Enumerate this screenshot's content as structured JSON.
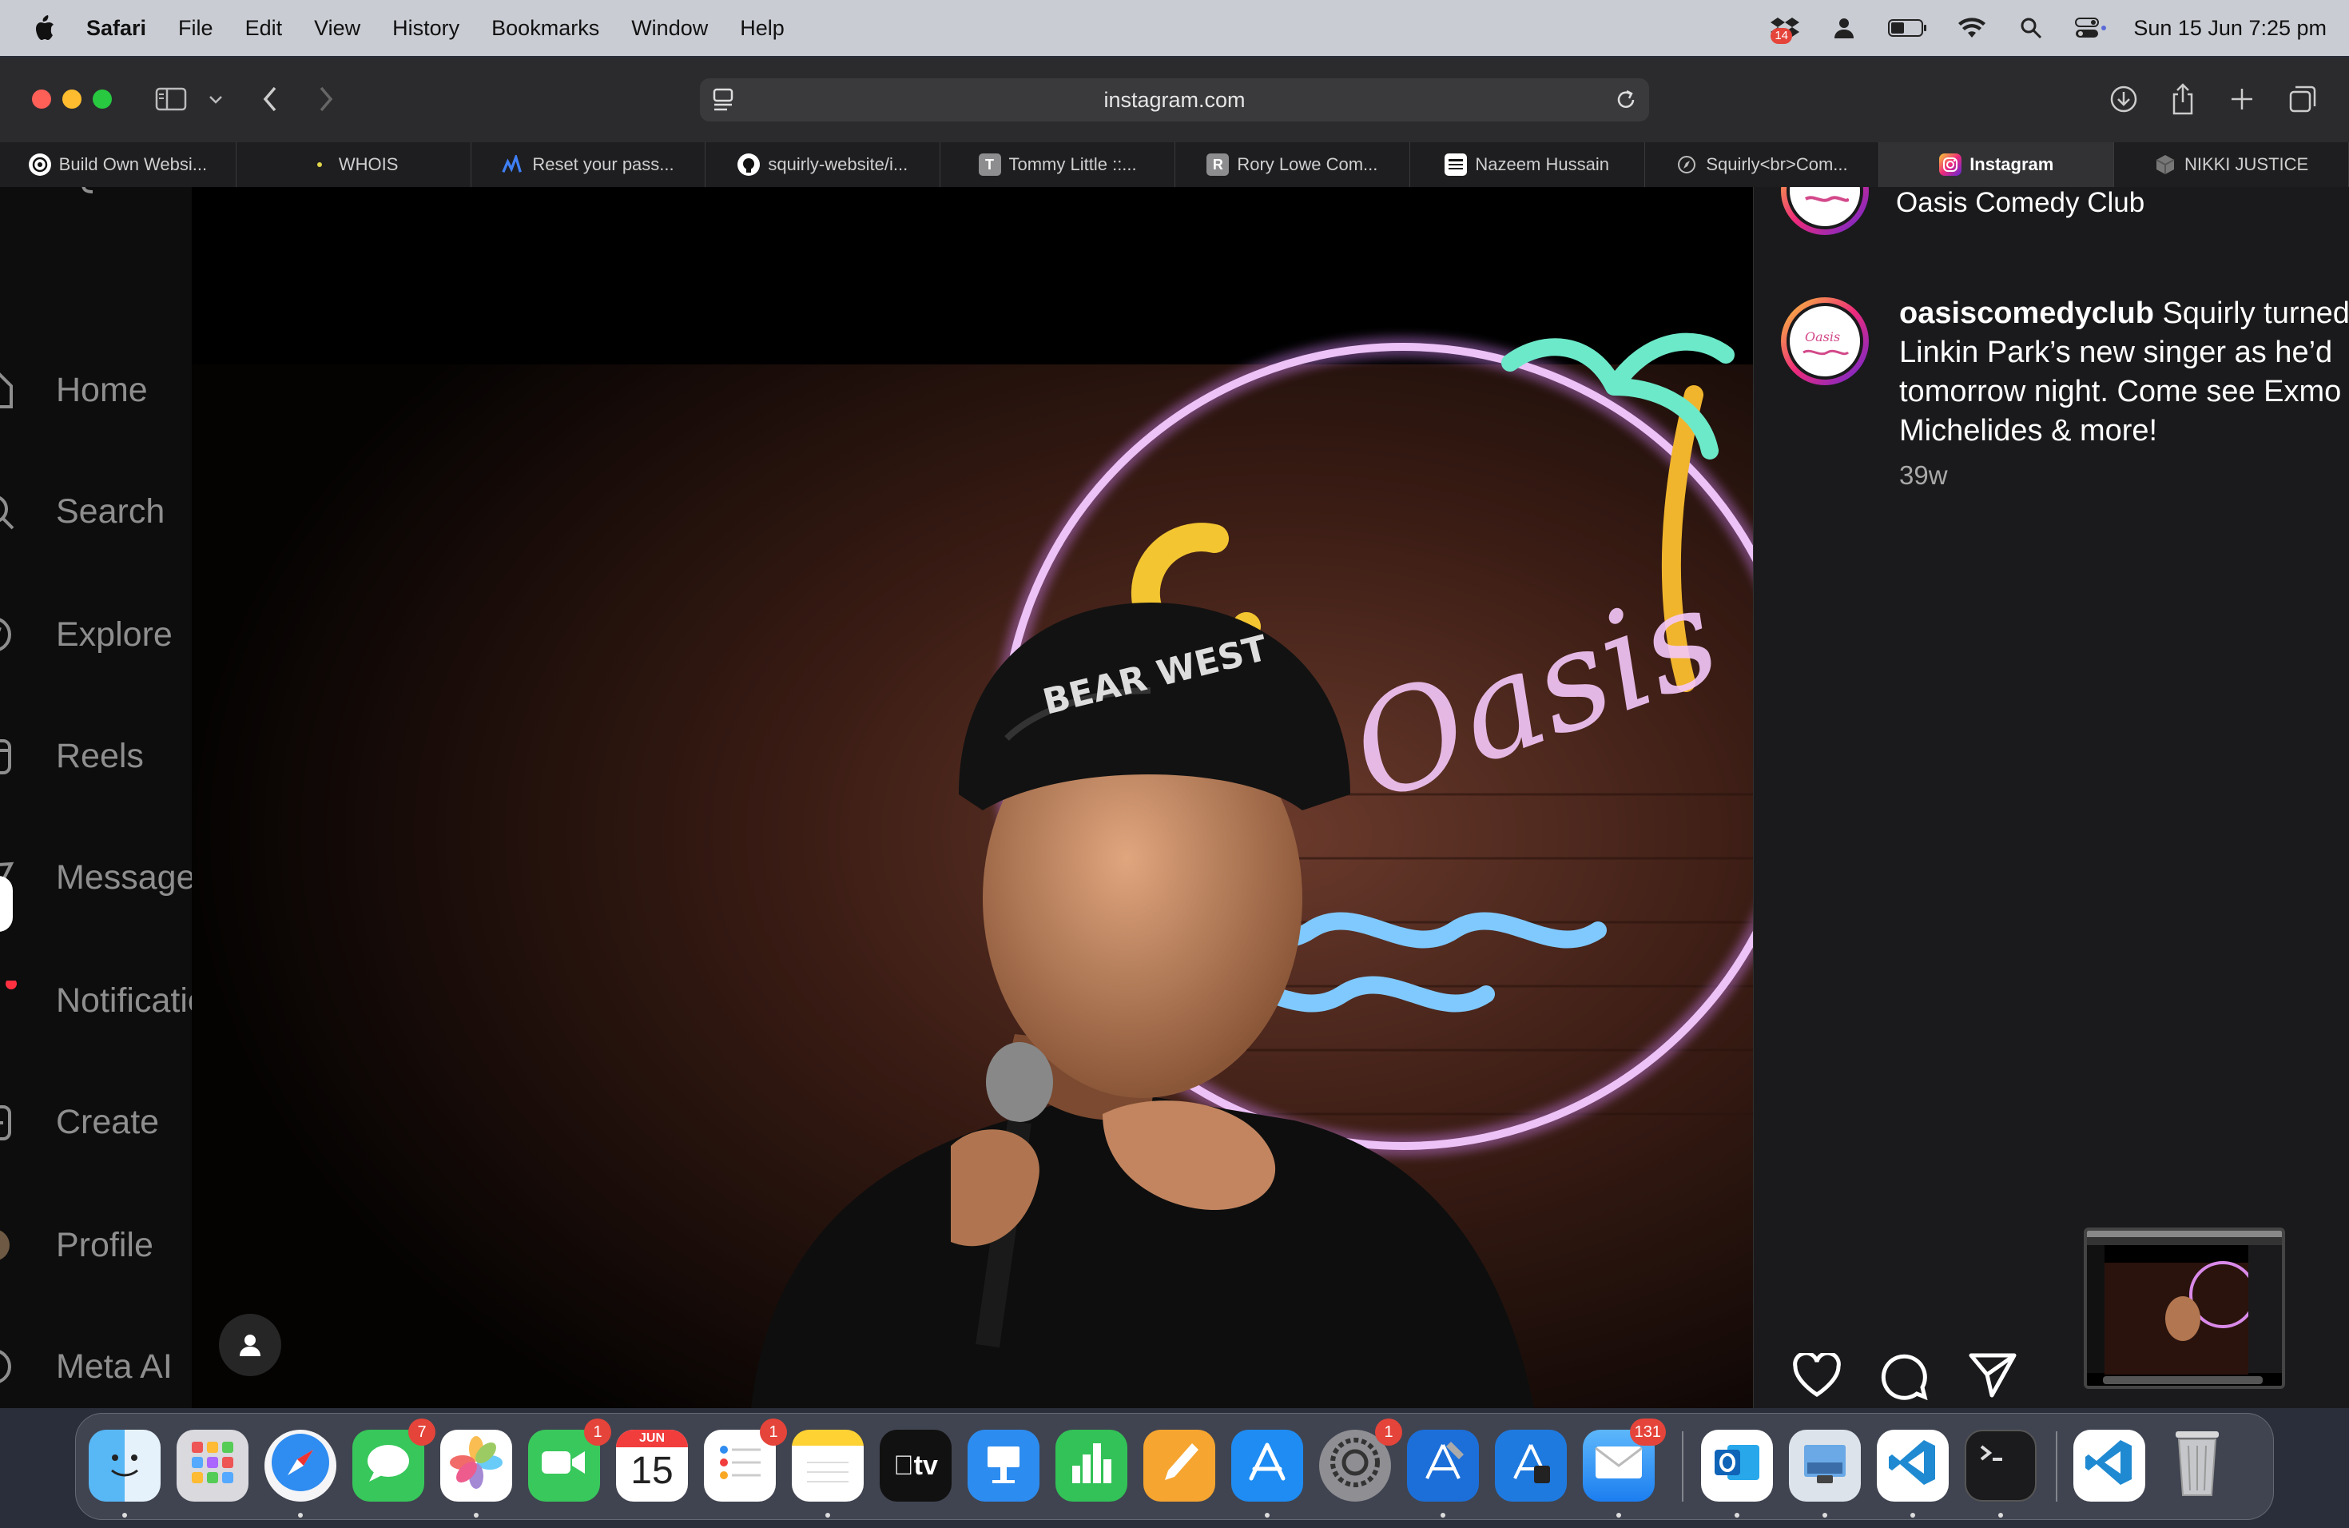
{
  "menubar": {
    "app": "Safari",
    "items": [
      "File",
      "Edit",
      "View",
      "History",
      "Bookmarks",
      "Window",
      "Help"
    ],
    "status_badge": "14",
    "clock": "Sun 15 Jun  7:25 pm"
  },
  "browser": {
    "url": "instagram.com",
    "tabs": [
      {
        "label": "Build Own Websi...",
        "icon": "openai-icon"
      },
      {
        "label": "WHOIS",
        "icon": "dot-icon"
      },
      {
        "label": "Reset your pass...",
        "icon": "chart-icon"
      },
      {
        "label": "squirly-website/i...",
        "icon": "github-icon"
      },
      {
        "label": "Tommy Little ::...",
        "icon": "letter-t-icon",
        "letter": "T"
      },
      {
        "label": "Rory Lowe Com...",
        "icon": "letter-r-icon",
        "letter": "R"
      },
      {
        "label": "Nazeem Hussain",
        "icon": "page-icon"
      },
      {
        "label": "Squirly<br>Com...",
        "icon": "compass-icon"
      },
      {
        "label": "Instagram",
        "icon": "instagram-icon",
        "active": true
      },
      {
        "label": "NIKKI JUSTICE",
        "icon": "cube-icon"
      }
    ]
  },
  "sidenav": {
    "items": [
      {
        "label": "Home",
        "icon": "home-icon"
      },
      {
        "label": "Search",
        "icon": "search-icon"
      },
      {
        "label": "Explore",
        "icon": "compass-icon"
      },
      {
        "label": "Reels",
        "icon": "reels-icon"
      },
      {
        "label": "Messages",
        "icon": "messenger-icon"
      },
      {
        "label": "Notifications",
        "icon": "heart-icon"
      },
      {
        "label": "Create",
        "icon": "plus-square-icon"
      },
      {
        "label": "Profile",
        "icon": "avatar-icon"
      },
      {
        "label": "Meta AI",
        "icon": "meta-ai-icon"
      }
    ]
  },
  "post": {
    "header_name": "Oasis Comedy Club",
    "username": "oasiscomedyclub",
    "caption_lines": [
      " Squirly turned",
      "Linkin Park’s new singer as he’d",
      "tomorrow night. Come see Exmo",
      "Michelides & more!"
    ],
    "time": "39w",
    "photo_sign_text": "Oasis Comedy",
    "cap_text": "BEAR WEST"
  },
  "dock": {
    "apps": [
      {
        "name": "Finder",
        "icon": "finder-icon",
        "running": true
      },
      {
        "name": "Launchpad",
        "icon": "launchpad-icon"
      },
      {
        "name": "Safari",
        "icon": "safari-icon",
        "running": true
      },
      {
        "name": "Messages",
        "icon": "messages-icon",
        "badge": "7"
      },
      {
        "name": "Photos",
        "icon": "photos-icon",
        "running": true
      },
      {
        "name": "FaceTime",
        "icon": "facetime-icon",
        "badge": "1"
      },
      {
        "name": "Calendar",
        "icon": "calendar-icon",
        "month": "JUN",
        "day": "15"
      },
      {
        "name": "Reminders",
        "icon": "reminders-icon",
        "badge": "1"
      },
      {
        "name": "Notes",
        "icon": "notes-icon",
        "running": true
      },
      {
        "name": "TV",
        "icon": "tv-icon",
        "label": "tv"
      },
      {
        "name": "Keynote",
        "icon": "keynote-icon"
      },
      {
        "name": "Numbers",
        "icon": "numbers-icon"
      },
      {
        "name": "Pages",
        "icon": "pages-icon"
      },
      {
        "name": "App Store",
        "icon": "appstore-icon",
        "running": true
      },
      {
        "name": "System Settings",
        "icon": "settings-icon",
        "badge": "1"
      },
      {
        "name": "Xcode",
        "icon": "xcode-icon",
        "running": true
      },
      {
        "name": "Simulator",
        "icon": "simulator-icon"
      },
      {
        "name": "Mail",
        "icon": "mail-icon",
        "badge": "131",
        "running": true
      },
      {
        "name": "Outlook",
        "icon": "outlook-icon",
        "running": true
      },
      {
        "name": "Preview",
        "icon": "preview-icon",
        "running": true
      },
      {
        "name": "VS Code",
        "icon": "vscode-icon",
        "running": true
      },
      {
        "name": "Terminal",
        "icon": "terminal-icon",
        "running": true
      },
      {
        "name": "VS Code Document",
        "icon": "vscode-doc-icon"
      },
      {
        "name": "Trash",
        "icon": "trash-icon"
      }
    ]
  }
}
